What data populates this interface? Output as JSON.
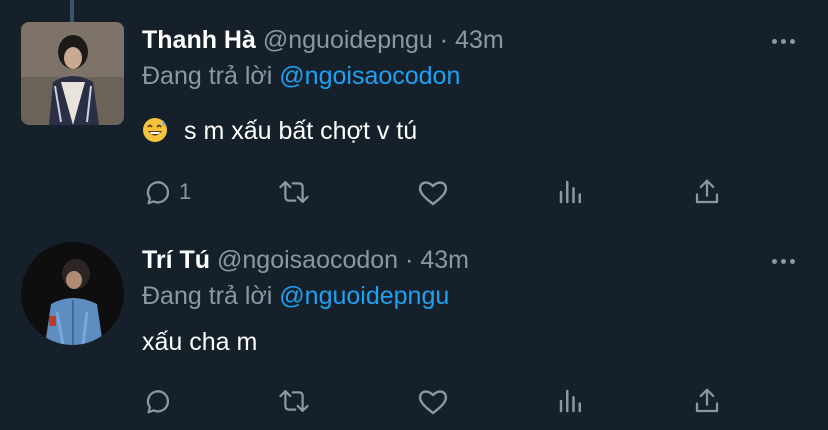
{
  "tweets": [
    {
      "name": "Thanh Hà",
      "handle": "@nguoidepngu",
      "dot": "·",
      "time": "43m",
      "reply_prefix": "Đang trả lời",
      "reply_to": "@ngoisaocodon",
      "text": "s m xấu bất chợt v tú",
      "emoji": "grinning-sweat-face",
      "reply_count": "1"
    },
    {
      "name": "Trí Tú",
      "handle": "@ngoisaocodon",
      "dot": "·",
      "time": "43m",
      "reply_prefix": "Đang trả lời",
      "reply_to": "@nguoidepngu",
      "text": "xấu cha m",
      "reply_count": ""
    }
  ],
  "colors": {
    "background": "#15202b",
    "secondary_text": "#8899a6",
    "accent": "#1da1f2",
    "thread_line": "#3d5466"
  },
  "icons": [
    "reply-icon",
    "retweet-icon",
    "like-icon",
    "analytics-icon",
    "share-icon",
    "more-icon"
  ]
}
